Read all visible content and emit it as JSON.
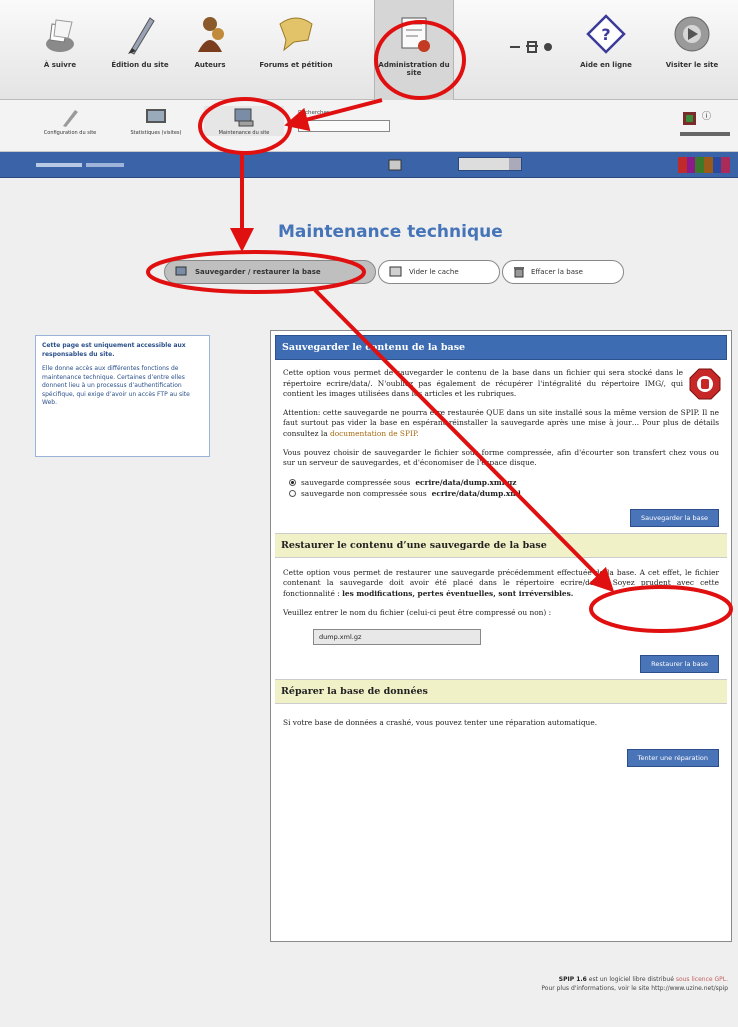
{
  "toolbar": {
    "items": [
      {
        "label": "À suivre",
        "icon": "tray-icon"
      },
      {
        "label": "Édition du site",
        "icon": "pen-icon"
      },
      {
        "label": "Auteurs",
        "icon": "authors-icon"
      },
      {
        "label": "Forums et pétition",
        "icon": "forums-icon"
      },
      {
        "label": "Administration du site",
        "icon": "admin-icon"
      },
      {
        "label": "Aide en ligne",
        "icon": "help-icon"
      },
      {
        "label": "Visiter le site",
        "icon": "visit-icon"
      }
    ]
  },
  "subtoolbar": {
    "items": [
      {
        "label": "Configuration du site",
        "icon": "config-icon"
      },
      {
        "label": "Statistiques (visites)",
        "icon": "stats-icon"
      },
      {
        "label": "Maintenance du site",
        "icon": "maintenance-icon"
      }
    ],
    "field_label": "Rechercher :"
  },
  "page": {
    "title": "Maintenance technique"
  },
  "tabs": [
    {
      "label": "Sauvegarder / restaurer la base",
      "icon": "database-icon",
      "active": true
    },
    {
      "label": "Vider le cache",
      "icon": "cache-icon",
      "active": false
    },
    {
      "label": "Effacer la base",
      "icon": "trash-icon",
      "active": false
    }
  ],
  "note": {
    "heading": "Cette page est uniquement accessible aux responsables du site.",
    "body": "Elle donne accès aux différentes fonctions de maintenance technique. Certaines d’entre elles donnent lieu à un processus d’authentification spécifique, qui exige d’avoir un accès FTP au site Web."
  },
  "backup": {
    "heading": "Sauvegarder le contenu de la base",
    "p1": "Cette option vous permet de sauvegarder le contenu de la base dans un fichier qui sera stocké dans le répertoire ecrire/data/. N'oubliez pas également de récupérer l'intégralité du répertoire IMG/, qui contient les images utilisées dans les articles et les rubriques.",
    "p2_text": "Attention: cette sauvegarde ne pourra être restaurée QUE dans un site installé sous la même version de SPIP. Il ne faut surtout pas vider la base en espérant réinstaller la sauvegarde après une mise à jour… Pour plus de détails consultez la",
    "p2_link": "documentation de SPIP.",
    "p3": "Vous pouvez choisir de sauvegarder le fichier sous forme compressée, afin d'écourter son transfert chez vous ou sur un serveur de sauvegardes, et d'économiser de l'espace disque.",
    "opt1_prefix": "sauvegarde compressée sous",
    "opt1_path": "ecrire/data/dump.xml.gz",
    "opt2_prefix": "sauvegarde non compressée sous",
    "opt2_path": "ecrire/data/dump.xml",
    "button": "Sauvegarder la base"
  },
  "restore": {
    "heading": "Restaurer le contenu d’une sauvegarde de la base",
    "p1_text": "Cette option vous permet de restaurer une sauvegarde précédemment effectuée de la base. A cet effet, le fichier contenant la sauvegarde doit avoir été placé dans le répertoire ecrire/data/. Soyez prudent avec cette fonctionnalité :",
    "p1_bold": "les modifications, pertes éventuelles, sont irréversibles.",
    "prompt": "Veuillez entrer le nom du fichier (celui-ci peut être compressé ou non) :",
    "field_value": "dump.xml.gz",
    "button": "Restaurer la base"
  },
  "repair": {
    "heading": "Réparer la base de données",
    "p1": "Si votre base de données a crashé, vous pouvez tenter une réparation automatique.",
    "button": "Tenter une réparation"
  },
  "footer": {
    "line1_bold": "SPIP 1.6",
    "line1_text": "est un logiciel libre distribué",
    "line1_link": "sous licence GPL.",
    "line2": "Pour plus d'informations, voir le site http://www.uzine.net/spip"
  },
  "colors": {
    "accent_blue": "#3d6cb3",
    "annotation_red": "#e01010",
    "yellow_header": "#f1f1c8"
  }
}
